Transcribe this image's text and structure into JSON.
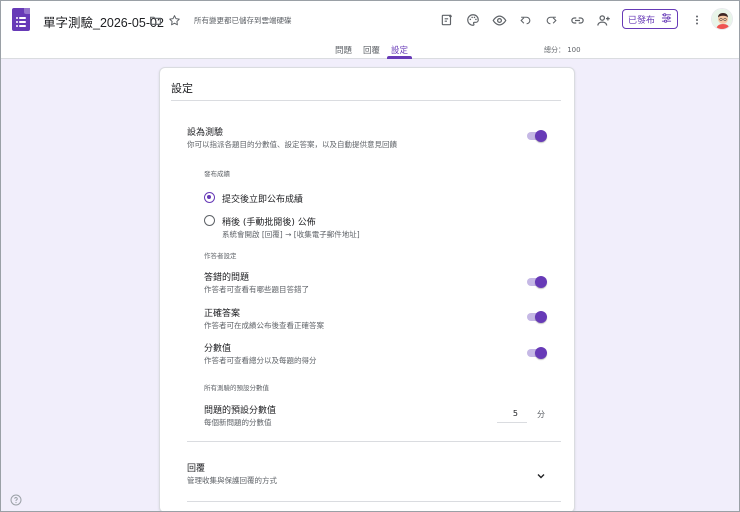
{
  "header": {
    "doc_title": "單字測驗_2026-05-02",
    "save_status": "所有變更都已儲存到雲端硬碟",
    "publish_label": "已發布",
    "icons": [
      "folder-icon",
      "star-icon",
      "addon-icon",
      "palette-icon",
      "preview-icon",
      "undo-icon",
      "redo-icon",
      "link-icon",
      "add-collaborator-icon",
      "more-vert-icon"
    ]
  },
  "tabs": {
    "questions": "問題",
    "responses": "回覆",
    "settings": "設定",
    "total_points": "總分： 100"
  },
  "settings": {
    "section_title": "設定",
    "quiz": {
      "title": "設為測驗",
      "description": "你可以指派各題目的分數值、設定答案，以及自動提供意見回饋",
      "enabled": true
    },
    "release_grade": {
      "heading": "發布成績",
      "option_immediate": "提交後立即公布成績",
      "option_later": "稍後 (手動批閱後) 公佈",
      "option_later_note": "系統會開啟 [回覆] → [收集電子郵件地址]",
      "selected": "immediate"
    },
    "respondent": {
      "heading": "作答者設定",
      "missed": {
        "title": "答錯的問題",
        "description": "作答者可查看有哪些題目答錯了",
        "enabled": true
      },
      "correct": {
        "title": "正確答案",
        "description": "作答者可在成績公布後查看正確答案",
        "enabled": true
      },
      "points": {
        "title": "分數值",
        "description": "作答者可查看總分以及每題的得分",
        "enabled": true
      }
    },
    "defaults": {
      "heading": "所有測驗的預設分數值",
      "title": "問題的預設分數值",
      "description": "每個新問題的分數值",
      "value": "5",
      "unit": "分"
    },
    "responses_section": {
      "title": "回覆",
      "description": "管理收集與保護回覆的方式"
    }
  },
  "colors": {
    "accent": "#673ab7",
    "background": "#f1eefb"
  }
}
